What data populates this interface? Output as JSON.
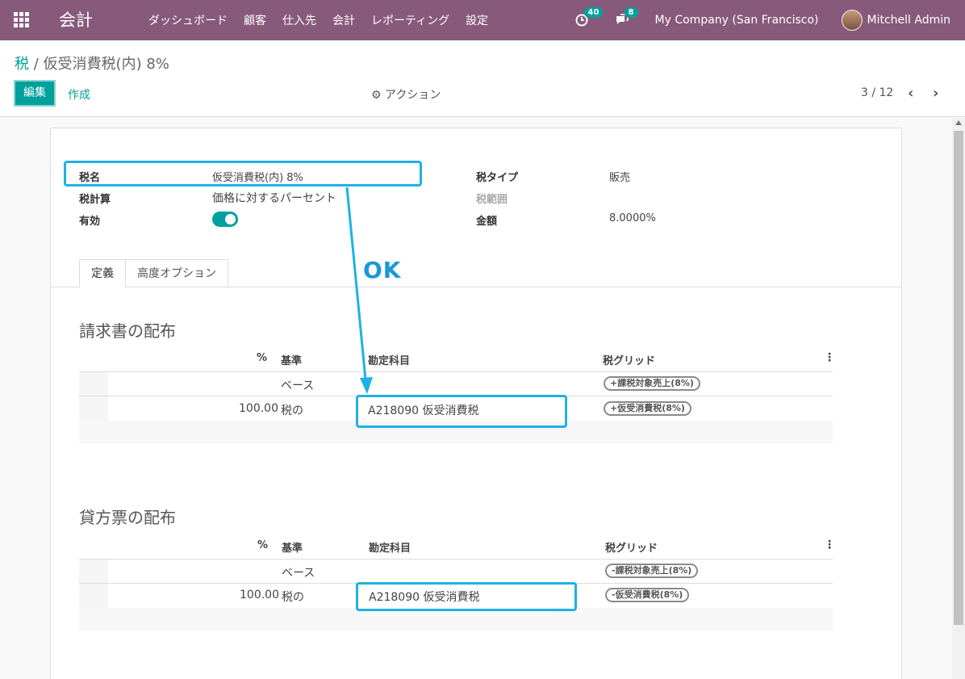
{
  "navbar": {
    "brand": "会計",
    "menu": [
      "ダッシュボード",
      "顧客",
      "仕入先",
      "会計",
      "レポーティング",
      "設定"
    ],
    "activity_badge": "40",
    "message_badge": "8",
    "company": "My Company (San Francisco)",
    "user": "Mitchell Admin"
  },
  "control": {
    "breadcrumb_parent": "税",
    "breadcrumb_sep": "/",
    "breadcrumb_current": "仮受消費税(内) 8%",
    "edit_label": "編集",
    "create_label": "作成",
    "action_label": "アクション",
    "pager": "3 / 12"
  },
  "form": {
    "name_label": "税名",
    "name_value": "仮受消費税(内) 8%",
    "computation_label": "税計算",
    "computation_value": "価格に対するパーセント",
    "active_label": "有効",
    "active": true,
    "type_label": "税タイプ",
    "type_value": "販売",
    "scope_label": "税範囲",
    "amount_label": "金額",
    "amount_value": "8.0000%"
  },
  "tabs": [
    "定義",
    "高度オプション"
  ],
  "annotation": "OK",
  "invoice": {
    "title": "請求書の配布",
    "headers": {
      "pct": "%",
      "base": "基準",
      "account": "勘定科目",
      "grid": "税グリッド"
    },
    "rows": [
      {
        "pct": "",
        "base": "ベース",
        "account": "",
        "grid": "+課税対象売上(8%)"
      },
      {
        "pct": "100.00",
        "base": "税の",
        "account": "A218090 仮受消費税",
        "grid": "+仮受消費税(8%)"
      }
    ]
  },
  "refund": {
    "title": "貸方票の配布",
    "headers": {
      "pct": "%",
      "base": "基準",
      "account": "勘定科目",
      "grid": "税グリッド"
    },
    "rows": [
      {
        "pct": "",
        "base": "ベース",
        "account": "",
        "grid": "-課税対象売上(8%)"
      },
      {
        "pct": "100.00",
        "base": "税の",
        "account": "A218090 仮受消費税",
        "grid": "-仮受消費税(8%)"
      }
    ]
  },
  "colors": {
    "primary": "#875a7b",
    "accent": "#00a09d",
    "highlight": "#1fb1e6"
  }
}
